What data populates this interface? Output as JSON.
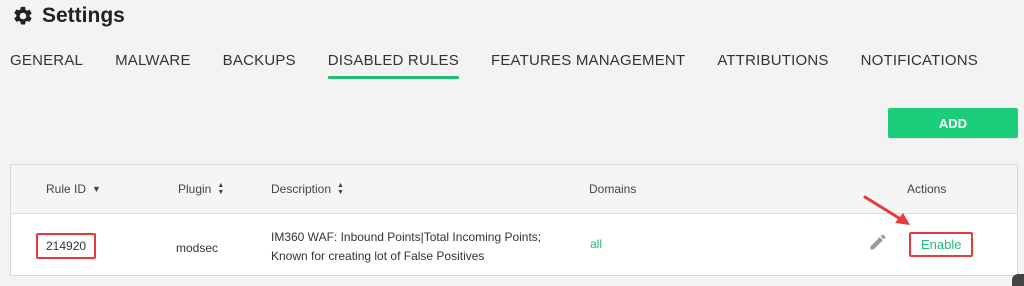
{
  "header": {
    "title": "Settings",
    "icon": "gear-icon"
  },
  "tabs": [
    {
      "label": "GENERAL",
      "active": false
    },
    {
      "label": "MALWARE",
      "active": false
    },
    {
      "label": "BACKUPS",
      "active": false
    },
    {
      "label": "DISABLED RULES",
      "active": true
    },
    {
      "label": "FEATURES MANAGEMENT",
      "active": false
    },
    {
      "label": "ATTRIBUTIONS",
      "active": false
    },
    {
      "label": "NOTIFICATIONS",
      "active": false
    }
  ],
  "toolbar": {
    "add_label": "ADD"
  },
  "table": {
    "columns": {
      "rule_id": "Rule ID",
      "plugin": "Plugin",
      "description": "Description",
      "domains": "Domains",
      "actions": "Actions"
    },
    "rows": [
      {
        "rule_id": "214920",
        "plugin": "modsec",
        "description_line1": "IM360 WAF: Inbound Points|Total Incoming Points;",
        "description_line2": "Known for creating lot of False Positives",
        "domains": "all",
        "enable_label": "Enable"
      }
    ]
  },
  "colors": {
    "accent": "#1ccd79",
    "highlight": "#e53b3b"
  }
}
